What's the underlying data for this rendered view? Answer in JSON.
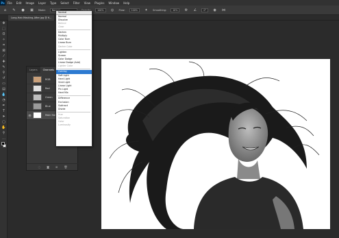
{
  "app": {
    "logo": "Ps"
  },
  "menubar": [
    "File",
    "Edit",
    "Image",
    "Layer",
    "Type",
    "Select",
    "Filter",
    "View",
    "Plugins",
    "Window",
    "Help"
  ],
  "options": {
    "mode_label": "Mode:",
    "mode_value": "Normal",
    "opacity_label": "Opacity:",
    "opacity_value": "100%",
    "flow_label": "Flow:",
    "flow_value": "100%",
    "smoothing_label": "Smoothing:",
    "smoothing_value": "10%",
    "angle_value": "0°"
  },
  "document_tab": "Long-Hair-Masking-After.jpg @ 6...",
  "blend_menu": {
    "header": "Normal",
    "groups": [
      [
        {
          "label": "Normal"
        },
        {
          "label": "Dissolve"
        },
        {
          "label": "Behind",
          "dim": true
        },
        {
          "label": "Clear",
          "dim": true
        }
      ],
      [
        {
          "label": "Darken"
        },
        {
          "label": "Multiply"
        },
        {
          "label": "Color Burn"
        },
        {
          "label": "Linear Burn"
        },
        {
          "label": "Darker Color",
          "dim": true
        }
      ],
      [
        {
          "label": "Lighten"
        },
        {
          "label": "Screen"
        },
        {
          "label": "Color Dodge"
        },
        {
          "label": "Linear Dodge (Add)"
        },
        {
          "label": "Lighter Color",
          "dim": true
        }
      ],
      [
        {
          "label": "Overlay",
          "highlight": true
        },
        {
          "label": "Soft Light"
        },
        {
          "label": "Hard Light"
        },
        {
          "label": "Vivid Light"
        },
        {
          "label": "Linear Light"
        },
        {
          "label": "Pin Light"
        },
        {
          "label": "Hard Mix"
        }
      ],
      [
        {
          "label": "Difference"
        },
        {
          "label": "Exclusion"
        },
        {
          "label": "Subtract"
        },
        {
          "label": "Divide"
        }
      ],
      [
        {
          "label": "Hue",
          "dim": true
        },
        {
          "label": "Saturation",
          "dim": true
        },
        {
          "label": "Color",
          "dim": true
        },
        {
          "label": "Luminosity",
          "dim": true
        }
      ]
    ]
  },
  "channels_panel": {
    "tabs": [
      "Layers",
      "Channels"
    ],
    "active_tab": 1,
    "rows": [
      {
        "label": "RGB",
        "visible": false,
        "color": "#c9a07a",
        "selected": false
      },
      {
        "label": "Red",
        "visible": false,
        "color": "#e0e0e0",
        "selected": false
      },
      {
        "label": "Green",
        "visible": false,
        "color": "#bdbdbd",
        "selected": false
      },
      {
        "label": "Blue",
        "visible": false,
        "color": "#9a9a9a",
        "selected": false
      },
      {
        "label": "Main Hair",
        "visible": true,
        "color": "#ffffff",
        "selected": true
      }
    ]
  },
  "colors": {
    "highlight": "#2d7ad1",
    "ui_dark": "#2b2b2b",
    "panel": "#383838"
  },
  "tools": [
    "move",
    "marquee",
    "lasso",
    "quick-select",
    "crop",
    "frame",
    "eyedropper",
    "spot-heal",
    "brush",
    "clone",
    "history-brush",
    "eraser",
    "gradient",
    "blur",
    "dodge",
    "pen",
    "type",
    "path-select",
    "rectangle",
    "hand",
    "zoom",
    "more",
    "foreground-background"
  ]
}
